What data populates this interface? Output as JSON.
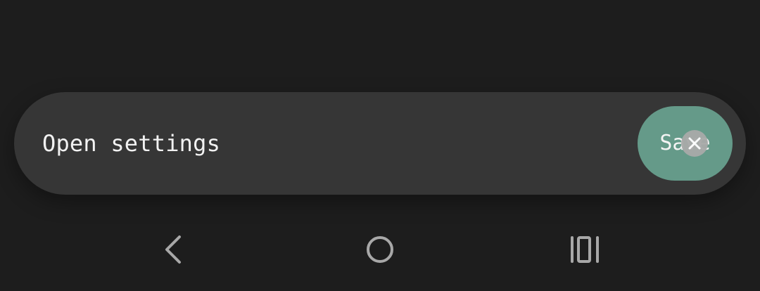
{
  "snackbar": {
    "message": "Open settings",
    "action_label": "Save",
    "action_color": "#659a89",
    "close_icon": "close-icon"
  },
  "navigation": {
    "back_icon": "back-chevron-icon",
    "home_icon": "home-circle-icon",
    "recents_icon": "recents-bars-icon",
    "icon_color": "#a8a8a8"
  },
  "theme": {
    "background": "#1d1d1d",
    "surface": "#363636"
  }
}
